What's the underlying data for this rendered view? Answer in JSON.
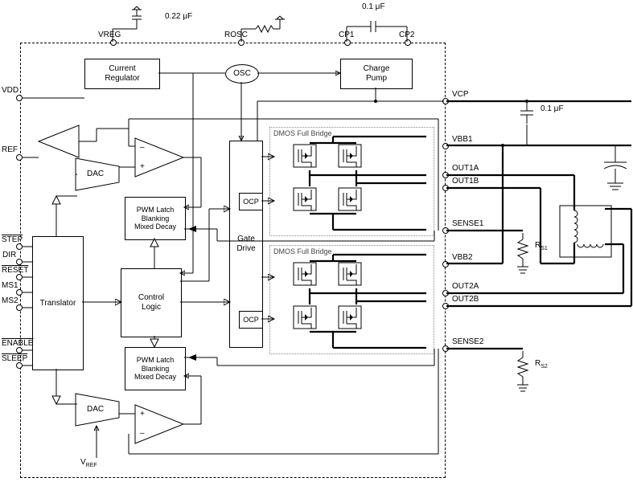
{
  "pins_left": [
    "VDD",
    "REF",
    "STEP",
    "DIR",
    "RESET",
    "MS1",
    "MS2",
    "ENABLE",
    "SLEEP"
  ],
  "pins_top": [
    "VREG",
    "ROSC",
    "CP1",
    "CP2"
  ],
  "pins_right": [
    "VCP",
    "VBB1",
    "OUT1A",
    "OUT1B",
    "SENSE1",
    "VBB2",
    "OUT2A",
    "OUT2B",
    "SENSE2"
  ],
  "blocks": {
    "curr_reg": "Current\nRegulator",
    "osc": "OSC",
    "charge_pump": "Charge\nPump",
    "translator": "Translator",
    "control": "Control\nLogic",
    "gate_drive": "Gate\nDrive",
    "pwm1": "PWM Latch\nBlanking\nMixed Decay",
    "pwm2": "PWM Latch\nBlanking\nMixed Decay",
    "dac1": "DAC",
    "dac2": "DAC",
    "ocp1": "OCP",
    "ocp2": "OCP",
    "bridge1": "DMOS Full Bridge",
    "bridge2": "DMOS Full Bridge"
  },
  "caps": {
    "c1": "0.22 μF",
    "c2": "0.1 μF",
    "c3": "0.1 μF"
  },
  "res": {
    "rs1": "R",
    "rs1_sub": "S1",
    "rs2": "R",
    "rs2_sub": "S2"
  },
  "plus": "+",
  "minus": "–",
  "vref": "V",
  "vref_sub": "REF"
}
